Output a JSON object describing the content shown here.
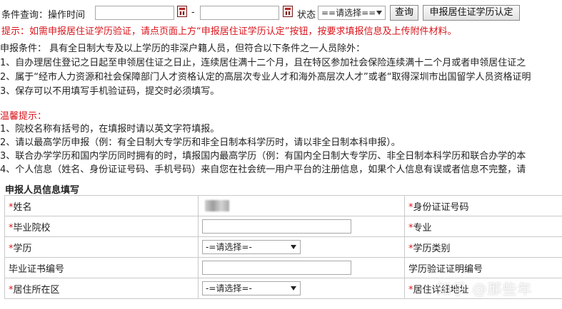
{
  "query": {
    "label": "条件查询：操作时间",
    "date_dash": "-",
    "status_label": "状态",
    "status_select": "==请选择==",
    "query_button": "查询",
    "apply_button": "申报居住证学历认定"
  },
  "tip_line": "提示：如需申报居住证学历验证，请点页面上方“申报居住证学历认定”按钮，按要求填报信息及上传附件材料。",
  "conditions": [
    "申报条件：  具有全日制大专及以上学历的非深户籍人员，但符合以下条件之一人员除外：",
    "1、自办理居住登记之日起至申领居住证之日止，连续居住满十二个月，且在特区参加社会保险连续满十二个月或者申领居住证之",
    "2、属于“经市人力资源和社会保障部门人才资格认定的高层次专业人才和海外高层次人才”或者“取得深圳市出国留学人员资格证明",
    "3、保存可以不用填写手机验证码，提交时必须填写。"
  ],
  "reminder": {
    "title": "温馨提示：",
    "items": [
      "1、院校名称有括号的，在填报时请以英文字符填报。",
      "2、请以最高学历申报（例：有全日制大专学历和非全日制本科学历时，请以非全日制本科申报）。",
      "3、联合办学学历和国内学历同时拥有的时，填报国内最高学历（例：有国内全日制大专学历、非全日制本科学历和联合办学的本",
      "4、个人信息（姓名、身份证证号码、手机号码）来自您在社会统一用户平台的注册信息，如果个人信息有误或者信息不完整，请"
    ]
  },
  "form": {
    "section_title": "申报人员信息填写",
    "required_mark": "*",
    "rows": [
      {
        "left_label": "姓名",
        "left_required": true,
        "right_label": "身份证证号码",
        "right_required": true
      },
      {
        "left_label": "毕业院校",
        "left_required": true,
        "right_label": "专业",
        "right_required": true
      },
      {
        "left_label": "学历",
        "left_required": true,
        "left_select": "-=请选择=-",
        "right_label": "学历类别",
        "right_required": true
      },
      {
        "left_label": "毕业证书编号",
        "left_required": false,
        "right_label": "学历验证证明编号",
        "right_required": false
      },
      {
        "left_label": "居住所在区",
        "left_required": true,
        "left_select": "-=请选择=-",
        "right_label": "居住详细地址",
        "right_required": true
      }
    ]
  },
  "watermark": "知乎 @那些年",
  "colors": {
    "accent_red": "#d9141b",
    "border": "#c9c9c9",
    "calendar_icon": "#7a1b1b"
  }
}
